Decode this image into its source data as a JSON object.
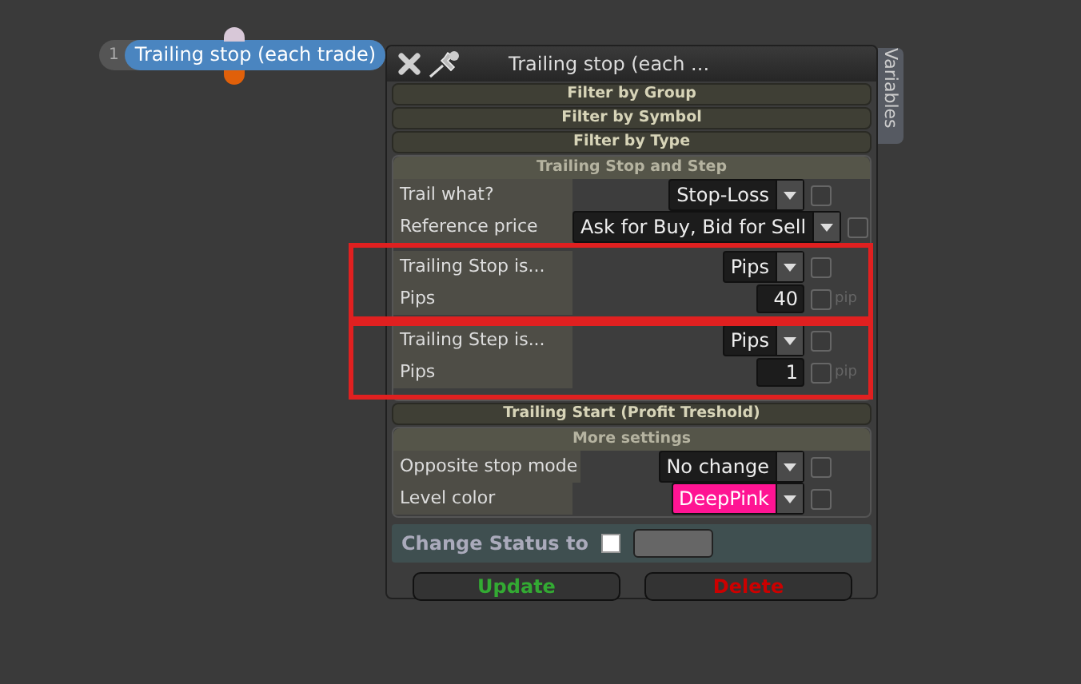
{
  "node": {
    "number": "1",
    "title": "Trailing stop (each trade)"
  },
  "panel": {
    "title": "Trailing stop (each ...",
    "side_tab": "Variables",
    "sections": [
      {
        "kind": "header",
        "title": "Filter by Group"
      },
      {
        "kind": "header",
        "title": "Filter by Symbol"
      },
      {
        "kind": "header",
        "title": "Filter by Type"
      },
      {
        "kind": "group",
        "title": "Trailing Stop and Step",
        "rows": [
          {
            "kind": "select",
            "label": "Trail what?",
            "value": "Stop-Loss",
            "checked": false
          },
          {
            "kind": "select",
            "label": "Reference price",
            "value": "Ask for Buy, Bid for Sell",
            "checked": false
          },
          {
            "kind": "frame",
            "rows": [
              {
                "kind": "select",
                "label": "Trailing Stop is...",
                "value": "Pips",
                "checked": false
              },
              {
                "kind": "number",
                "label": "Pips",
                "value": "40",
                "checked": false,
                "unit": "pip"
              }
            ]
          },
          {
            "kind": "frame",
            "rows": [
              {
                "kind": "select",
                "label": "Trailing Step is...",
                "value": "Pips",
                "checked": false
              },
              {
                "kind": "number",
                "label": "Pips",
                "value": "1",
                "checked": false,
                "unit": "pip"
              }
            ]
          }
        ]
      },
      {
        "kind": "header",
        "title": "Trailing Start (Profit Treshold)"
      },
      {
        "kind": "group",
        "title": "More settings",
        "rows": [
          {
            "kind": "select",
            "label": "Opposite stop mode",
            "value": "No change",
            "checked": false
          },
          {
            "kind": "select",
            "label": "Level color",
            "value": "DeepPink",
            "checked": false,
            "color": "#ff1493"
          }
        ]
      }
    ],
    "status": {
      "label": "Change Status to",
      "checked": false
    },
    "buttons": [
      {
        "label": "Update",
        "kind": "update"
      },
      {
        "label": "Delete",
        "kind": "delete"
      }
    ]
  }
}
